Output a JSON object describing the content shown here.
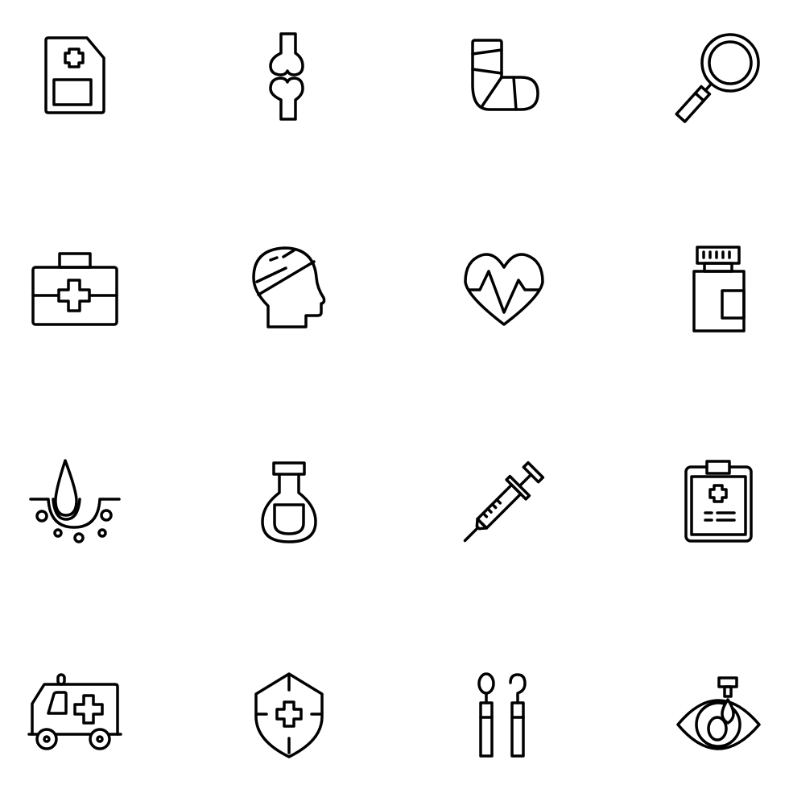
{
  "background_color": "#ffffff",
  "stroke_color": "#000000",
  "style": "outline line icons",
  "icons": [
    {
      "name": "medical-card-icon"
    },
    {
      "name": "bone-joint-icon"
    },
    {
      "name": "leg-cast-icon"
    },
    {
      "name": "magnifier-icon"
    },
    {
      "name": "first-aid-kit-icon"
    },
    {
      "name": "bandaged-head-icon"
    },
    {
      "name": "heartbeat-icon"
    },
    {
      "name": "pill-bottle-icon"
    },
    {
      "name": "hair-follicle-icon"
    },
    {
      "name": "flask-icon"
    },
    {
      "name": "syringe-icon"
    },
    {
      "name": "medical-clipboard-icon"
    },
    {
      "name": "ambulance-icon"
    },
    {
      "name": "medical-shield-icon"
    },
    {
      "name": "dental-tools-icon"
    },
    {
      "name": "eye-drops-icon"
    }
  ]
}
